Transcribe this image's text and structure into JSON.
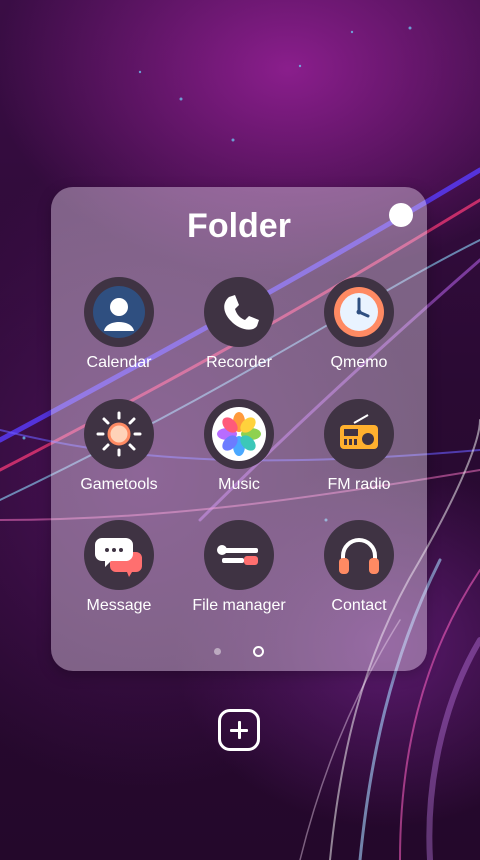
{
  "folder": {
    "title": "Folder",
    "apps": [
      {
        "label": "Calendar",
        "icon": "person-silhouette-icon"
      },
      {
        "label": "Recorder",
        "icon": "phone-handset-icon"
      },
      {
        "label": "Qmemo",
        "icon": "clock-icon"
      },
      {
        "label": "Gametools",
        "icon": "sun-icon"
      },
      {
        "label": "Music",
        "icon": "flower-petals-icon"
      },
      {
        "label": "FM radio",
        "icon": "radio-icon"
      },
      {
        "label": "Message",
        "icon": "chat-bubbles-icon"
      },
      {
        "label": "File manager",
        "icon": "tools-icon"
      },
      {
        "label": "Contact",
        "icon": "headphones-icon"
      }
    ],
    "page_indicator": {
      "total": 2,
      "current": 2
    }
  },
  "add_button": {
    "icon": "plus-icon"
  }
}
